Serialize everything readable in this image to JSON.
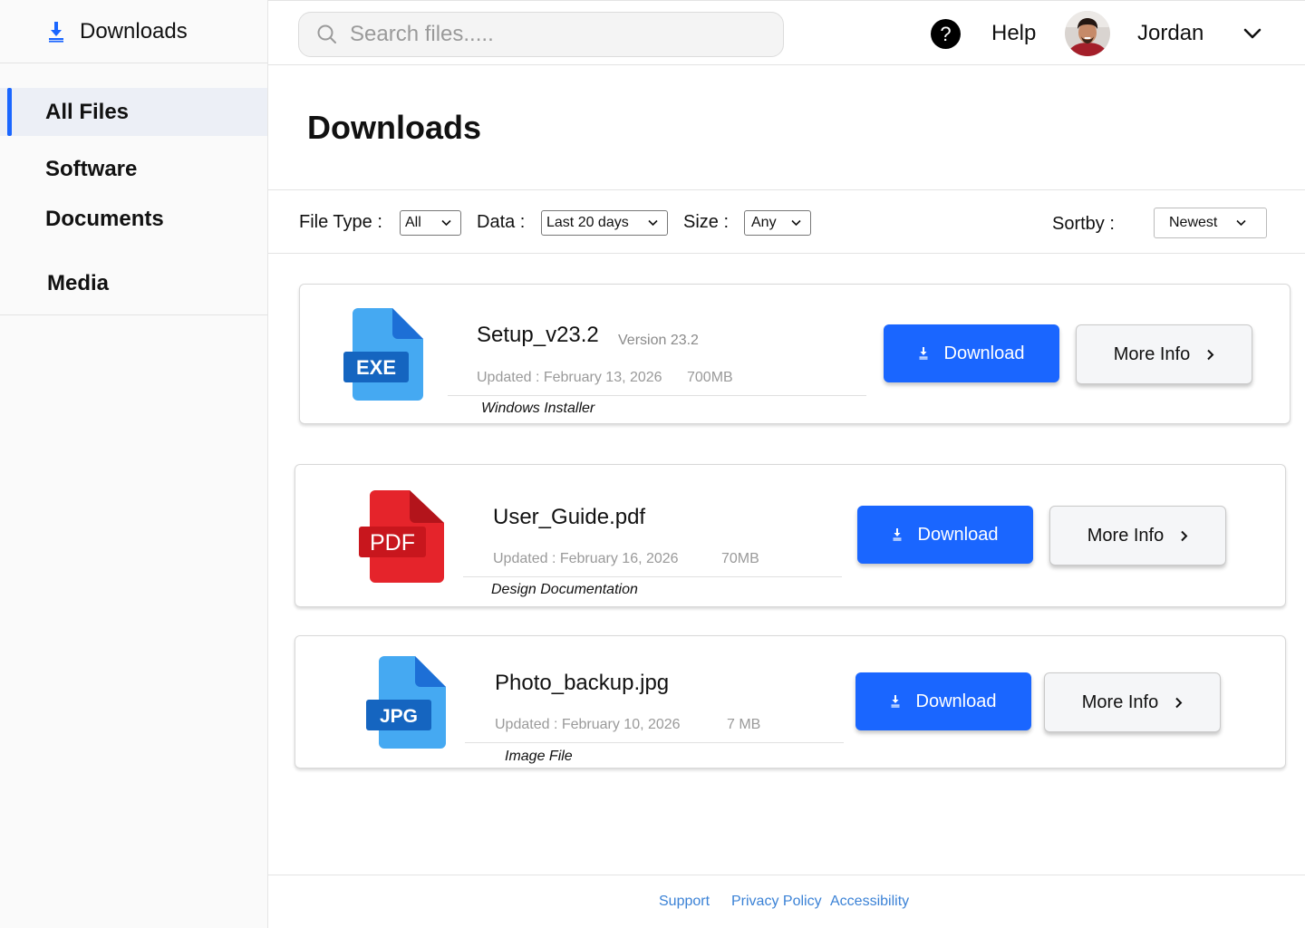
{
  "sidebar": {
    "brand": "Downloads",
    "items": [
      {
        "label": "All Files",
        "active": true
      },
      {
        "label": "Software"
      },
      {
        "label": "Documents"
      },
      {
        "label": "Media"
      }
    ]
  },
  "header": {
    "search_placeholder": "Search files.....",
    "help_glyph": "?",
    "help_label": "Help",
    "user_name": "Jordan"
  },
  "page": {
    "title": "Downloads"
  },
  "filters": {
    "file_type_label": "File Type :",
    "file_type_value": "All",
    "date_label": "Data :",
    "date_value": "Last 20 days",
    "size_label": "Size :",
    "size_value": "Any",
    "sort_label": "Sortby :",
    "sort_value": "Newest"
  },
  "files": [
    {
      "icon": "exe-file-icon",
      "badge": "EXE",
      "name": "Setup_v23.2",
      "version": "Version 23.2",
      "updated": "Updated :  February 13, 2026",
      "size": "700MB",
      "description": "Windows Installer",
      "download_label": "Download",
      "info_label": "More Info"
    },
    {
      "icon": "pdf-file-icon",
      "badge": "PDF",
      "name": "User_Guide.pdf",
      "version": "",
      "updated": "Updated :  February 16, 2026",
      "size": "70MB",
      "description": "Design Documentation",
      "download_label": "Download",
      "info_label": "More Info"
    },
    {
      "icon": "jpg-file-icon",
      "badge": "JPG",
      "name": "Photo_backup.jpg",
      "version": "",
      "updated": "Updated :  February 10, 2026",
      "size": "7  MB",
      "description": "Image File",
      "download_label": "Download",
      "info_label": "More Info"
    }
  ],
  "footer": {
    "support": "Support",
    "privacy": "Privacy Policy",
    "accessibility": "Accessibility"
  },
  "colors": {
    "accent": "#1a66ff",
    "exe_blue": "#3ea3ef",
    "pdf_red": "#e5242b",
    "jpg_blue": "#3ea3ef",
    "link": "#3b82d6"
  }
}
